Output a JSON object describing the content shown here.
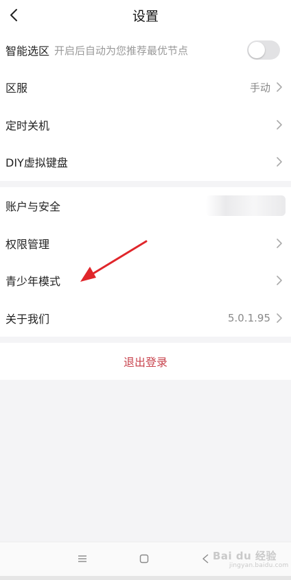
{
  "header": {
    "title": "设置"
  },
  "settings_group_1": [
    {
      "label": "智能选区",
      "sub": "开启后自动为您推荐最优节点",
      "control": "toggle",
      "toggle_on": false
    },
    {
      "label": "区服",
      "value": "手动"
    },
    {
      "label": "定时关机"
    },
    {
      "label": "DIY虚拟键盘"
    }
  ],
  "settings_group_2": [
    {
      "label": "账户与安全"
    },
    {
      "label": "权限管理"
    },
    {
      "label": "青少年模式"
    },
    {
      "label": "关于我们",
      "value": "5.0.1.95"
    }
  ],
  "logout": {
    "label": "退出登录"
  },
  "watermark": {
    "logo": "Bai du 经验",
    "sub": "jingyan.baidu.com"
  },
  "colors": {
    "logout_text": "#c8434d",
    "annotation_arrow": "#e0262b",
    "toggle_off": "#e2e2e4",
    "page_bg": "#f4f4f6"
  },
  "icons": {
    "back": "chevron-left-icon",
    "row_arrow": "chevron-right-icon",
    "nav_menu": "menu-icon",
    "nav_home": "square-home-icon",
    "nav_back": "triangle-back-icon"
  }
}
